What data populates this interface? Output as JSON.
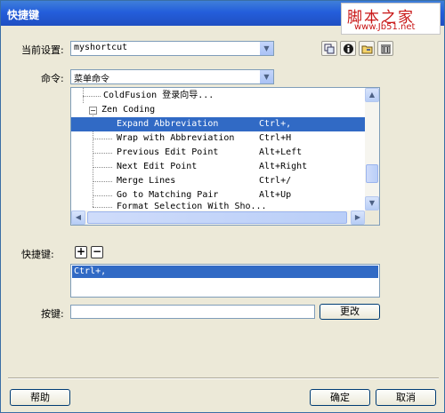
{
  "window": {
    "title": "快捷键"
  },
  "watermark": {
    "main": "脚本之家",
    "sub": "www.Jb51.net"
  },
  "current_set": {
    "label": "当前设置:",
    "value": "myshortcut"
  },
  "toolbar_icons": [
    "duplicate-set-icon",
    "info-icon",
    "export-icon",
    "trash-icon"
  ],
  "command": {
    "label": "命令:",
    "value": "菜单命令"
  },
  "tree": {
    "items": [
      {
        "name": "ColdFusion 登录向导...",
        "keys": "",
        "level": 1,
        "selected": false
      },
      {
        "name": "Zen Coding",
        "keys": "",
        "level": 1,
        "selected": false,
        "expanded": true
      },
      {
        "name": "Expand Abbreviation",
        "keys": "Ctrl+,",
        "level": 2,
        "selected": true
      },
      {
        "name": "Wrap with Abbreviation",
        "keys": "Ctrl+H",
        "level": 2,
        "selected": false
      },
      {
        "name": "Previous Edit Point",
        "keys": "Alt+Left",
        "level": 2,
        "selected": false
      },
      {
        "name": "Next Edit Point",
        "keys": "Alt+Right",
        "level": 2,
        "selected": false
      },
      {
        "name": "Merge Lines",
        "keys": "Ctrl+/",
        "level": 2,
        "selected": false
      },
      {
        "name": "Go to Matching Pair",
        "keys": "Alt+Up",
        "level": 2,
        "selected": false
      },
      {
        "name": "Format Selection With Sho...",
        "keys": "",
        "level": 2,
        "selected": false
      }
    ],
    "expander_symbol": "−"
  },
  "shortcut": {
    "label": "快捷键:",
    "add_symbol": "+",
    "remove_symbol": "−",
    "items": [
      "Ctrl+,"
    ]
  },
  "keypress": {
    "label": "按键:",
    "value": "",
    "change_label": "更改"
  },
  "footer": {
    "help_label": "帮助",
    "ok_label": "确定",
    "cancel_label": "取消"
  },
  "colors": {
    "selection": "#316ac5",
    "titlebar": "#245edb",
    "dialog_bg": "#ece9d8"
  }
}
